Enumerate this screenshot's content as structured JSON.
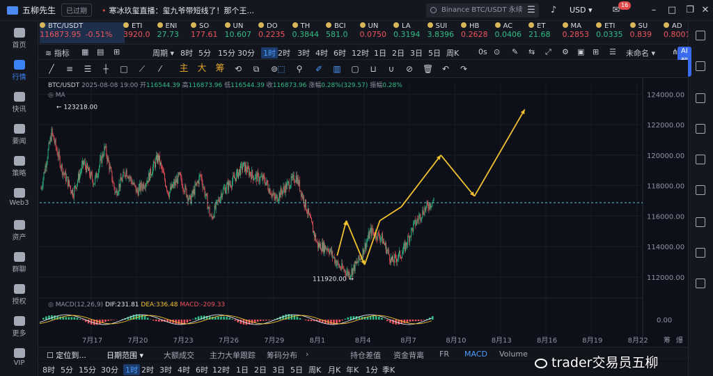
{
  "titlebar": {
    "app_name": "五柳先生",
    "expired_label": "已过期",
    "news": "寒冰玖玺直播：玺九爷带短线了！那个王...",
    "search_placeholder": "Binance BTC/USDT 永续",
    "currency": "USD",
    "mail_badge": "16"
  },
  "sidebar": {
    "items": [
      {
        "label": "首页",
        "icon": "home-icon"
      },
      {
        "label": "行情",
        "icon": "bar-chart-icon"
      },
      {
        "label": "快讯",
        "icon": "flash-news-icon"
      },
      {
        "label": "要闻",
        "icon": "news-icon"
      },
      {
        "label": "策略",
        "icon": "strategy-icon"
      },
      {
        "label": "Web3",
        "icon": "web3-icon"
      },
      {
        "label": "资产",
        "icon": "wallet-icon"
      },
      {
        "label": "群聊",
        "icon": "chat-icon"
      },
      {
        "label": "授权",
        "icon": "authorize-icon"
      },
      {
        "label": "更多",
        "icon": "more-icon"
      },
      {
        "label": "VIP",
        "icon": "vip-icon"
      }
    ]
  },
  "tickers": [
    {
      "symbol": "BTC/USDT",
      "price": "116873.95",
      "change": "-0.51%",
      "dir": "down"
    },
    {
      "symbol": "ETI",
      "price": "3920.0",
      "dir": "down"
    },
    {
      "symbol": "ENI",
      "price": "27.73",
      "dir": "up"
    },
    {
      "symbol": "SO",
      "price": "177.61",
      "dir": "down"
    },
    {
      "symbol": "UN",
      "price": "10.607",
      "dir": "up"
    },
    {
      "symbol": "DO",
      "price": "0.2235",
      "dir": "down"
    },
    {
      "symbol": "TH",
      "price": "0.3844",
      "dir": "up"
    },
    {
      "symbol": "BCI",
      "price": "581.0",
      "dir": "up"
    },
    {
      "symbol": "UN",
      "price": "0.0750",
      "dir": "down"
    },
    {
      "symbol": "LA",
      "price": "0.3194",
      "dir": "up"
    },
    {
      "symbol": "SUI",
      "price": "3.8396",
      "dir": "up"
    },
    {
      "symbol": "HB",
      "price": "0.2628",
      "dir": "down"
    },
    {
      "symbol": "AC",
      "price": "0.0406",
      "dir": "up"
    },
    {
      "symbol": "ET",
      "price": "21.68",
      "dir": "up"
    },
    {
      "symbol": "MA",
      "price": "0.2853",
      "dir": "down"
    },
    {
      "symbol": "ETI",
      "price": "0.0335",
      "dir": "up"
    },
    {
      "symbol": "SU",
      "price": "0.839",
      "dir": "down"
    },
    {
      "symbol": "AD",
      "price": "0.8001",
      "dir": "down"
    }
  ],
  "toolbar1": {
    "indicators": "指标",
    "period_label": "周期",
    "periods": [
      "8时",
      "5分",
      "15分",
      "30分",
      "1时",
      "2时",
      "3时",
      "4时",
      "6时",
      "12时",
      "1日",
      "2日",
      "3日",
      "5日",
      "周K"
    ],
    "active_period": "1时",
    "zero_s": "0s",
    "unnamed": "未命名",
    "ai": "AI解读"
  },
  "toolbar2": {
    "zh_buttons": [
      "主",
      "大",
      "筹"
    ]
  },
  "chart_info": {
    "symbol": "BTC/USDT",
    "datetime": "2025-08-08 19:00",
    "open_label": "开",
    "open": "116544.39",
    "high_label": "高",
    "high": "116873.96",
    "low_label": "低",
    "low": "116544.39",
    "close_label": "收",
    "close": "116873.96",
    "change_label": "涨幅",
    "change": "0.28%(329.57)",
    "amp_label": "振幅",
    "amp": "0.28%",
    "ma_label": "MA",
    "high_mark": "123218.00",
    "low_mark": "111920.00"
  },
  "macd": {
    "label": "MACD(12,26,9)",
    "dif": "DIF:231.81",
    "dea": "DEA:336.48",
    "macd": "MACD:-209.33",
    "zero": "0.00"
  },
  "chart_data": {
    "type": "candlestick",
    "y_ticks": [
      112000,
      114000,
      116000,
      118000,
      120000,
      122000,
      124000
    ],
    "y_tick_labels": [
      "112000.00",
      "114000.00",
      "116000.00",
      "118000.00",
      "120000.00",
      "122000.00",
      "124000.00"
    ],
    "ylim": [
      110800,
      124700
    ],
    "x_labels": [
      "7月17",
      "7月20",
      "7月23",
      "7月26",
      "7月29",
      "8月1",
      "8月4",
      "8月7",
      "8月10",
      "8月13",
      "8月16",
      "8月19",
      "8月22"
    ],
    "current_price": 116873.96,
    "high": 123218.0,
    "low": 111920.0,
    "path_points": [
      [
        0,
        117800
      ],
      [
        1,
        121500
      ],
      [
        2,
        119000
      ],
      [
        3,
        117500
      ],
      [
        4,
        119500
      ],
      [
        5,
        118200
      ],
      [
        6,
        120500
      ],
      [
        7,
        117500
      ],
      [
        8,
        119000
      ],
      [
        9,
        117600
      ],
      [
        10,
        118400
      ],
      [
        11,
        119900
      ],
      [
        12,
        117500
      ],
      [
        13,
        118600
      ],
      [
        14,
        117000
      ],
      [
        15,
        118700
      ],
      [
        16,
        115800
      ],
      [
        17,
        117600
      ],
      [
        18,
        118300
      ],
      [
        19,
        119300
      ],
      [
        20,
        118600
      ],
      [
        21,
        118400
      ],
      [
        22,
        117100
      ],
      [
        23,
        117900
      ],
      [
        24,
        118600
      ],
      [
        25,
        116400
      ],
      [
        26,
        114100
      ],
      [
        27,
        113900
      ],
      [
        28,
        112700
      ],
      [
        29,
        112200
      ],
      [
        30,
        113200
      ],
      [
        31,
        115000
      ],
      [
        32,
        114600
      ],
      [
        33,
        113000
      ],
      [
        34,
        113600
      ],
      [
        35,
        115300
      ],
      [
        36,
        116400
      ],
      [
        37,
        117100
      ]
    ],
    "projection_path": [
      [
        0,
        113400
      ],
      [
        1,
        115700
      ],
      [
        2,
        112800
      ],
      [
        3,
        115700
      ],
      [
        4,
        116600
      ],
      [
        5,
        120000
      ],
      [
        6,
        117300
      ],
      [
        7,
        123000
      ]
    ],
    "projection_x_days": [
      3.6,
      4.2,
      5.4,
      6.4,
      7.8,
      10.4,
      12.6,
      15.9
    ],
    "start_day": 16
  }
}
